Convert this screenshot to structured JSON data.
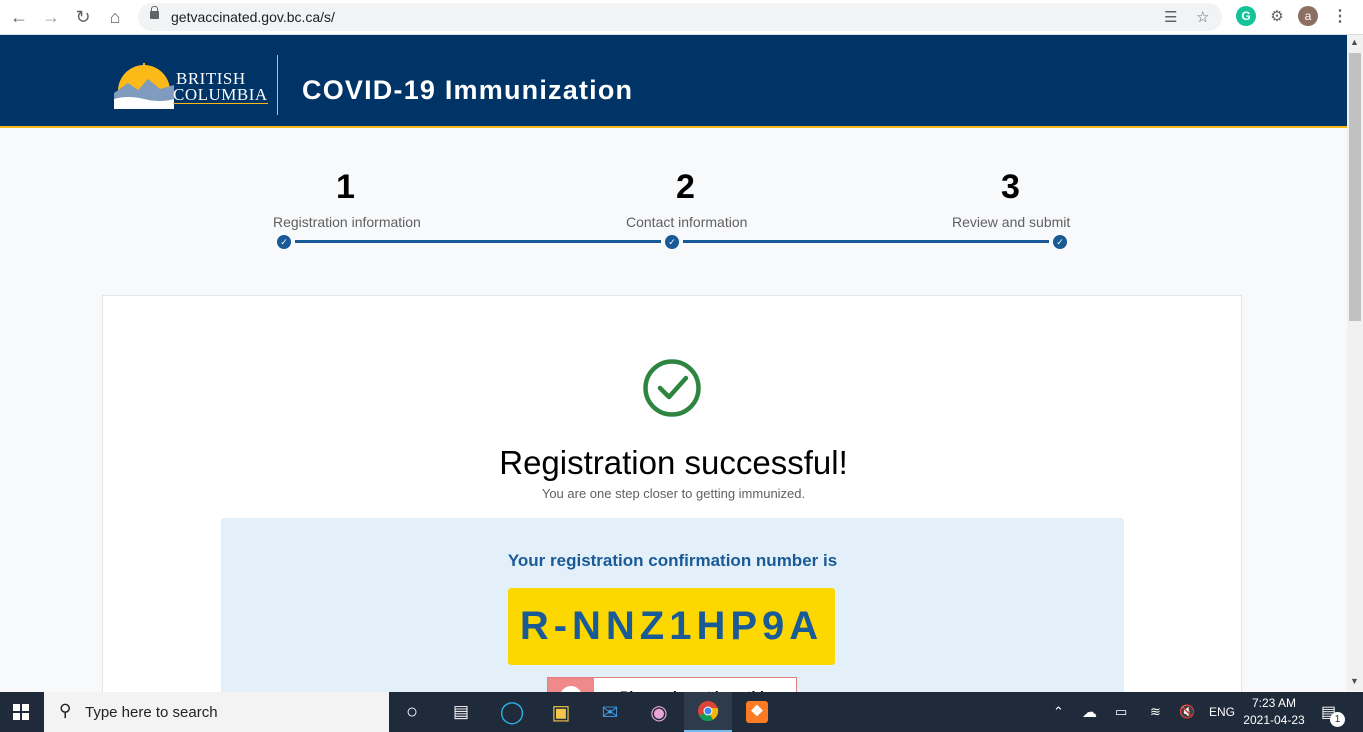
{
  "browser": {
    "url": "getvaccinated.gov.bc.ca/s/",
    "profile_initial": "a"
  },
  "header": {
    "logo_line1": "BRITISH",
    "logo_line2": "COLUMBIA",
    "title": "COVID-19 Immunization"
  },
  "stepper": {
    "steps": [
      {
        "number": "1",
        "label": "Registration information"
      },
      {
        "number": "2",
        "label": "Contact information"
      },
      {
        "number": "3",
        "label": "Review and submit"
      }
    ]
  },
  "result": {
    "title": "Registration successful!",
    "subtitle": "You are one step closer to getting immunized.",
    "confirmation_label": "Your registration confirmation number is",
    "confirmation_number": "R-NNZ1HP9A",
    "notice_text": "Please do not lose this"
  },
  "taskbar": {
    "search_placeholder": "Type here to search",
    "language": "ENG",
    "time": "7:23 AM",
    "date": "2021-04-23",
    "notification_count": "1"
  },
  "colors": {
    "header_bg": "#003366",
    "accent_gold": "#fcba19",
    "step_blue": "#1a5a96",
    "confirm_yellow": "#fcd800",
    "success_green": "#2e8540"
  }
}
